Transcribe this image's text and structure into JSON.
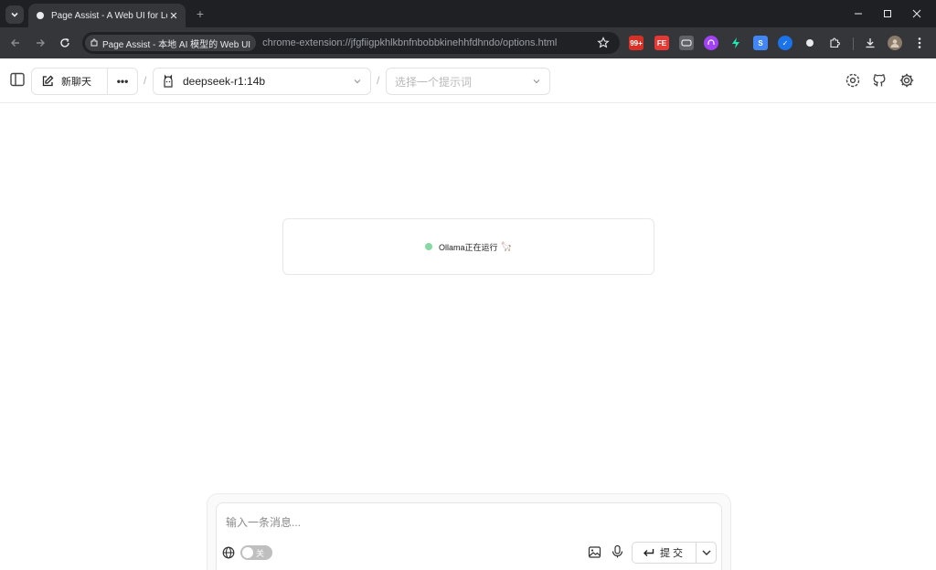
{
  "browser": {
    "tab_title": "Page Assist - A Web UI for Lo",
    "new_tab_symbol": "+",
    "tab_close_symbol": "✕",
    "site_chip_label": "Page Assist - 本地 AI 模型的 Web UI",
    "url": "chrome-extension://jfgfiigpkhlkbnfnbobbkinehhfdhndo/options.html",
    "extensions": [
      {
        "name": "notification-badge-extension",
        "label": "99+",
        "color": "#d93025"
      },
      {
        "name": "fe-extension",
        "label": "FE",
        "color": "#e53935"
      },
      {
        "name": "gamepad-extension",
        "label": "",
        "color": "#5f6368"
      },
      {
        "name": "purple-extension",
        "label": "",
        "color": "#a142f4"
      },
      {
        "name": "bolt-extension",
        "label": "",
        "color": "#1de9b6"
      },
      {
        "name": "s-extension",
        "label": "S",
        "color": "#4285f4"
      },
      {
        "name": "check-extension",
        "label": "✓",
        "color": "#1a73e8"
      },
      {
        "name": "dot-extension",
        "label": "",
        "color": "#e8eaed"
      }
    ]
  },
  "header": {
    "new_chat_label": "新聊天",
    "more_label": "•••",
    "separator": "/",
    "model_name": "deepseek-r1:14b",
    "prompt_placeholder": "选择一个提示词"
  },
  "status": {
    "text": "Ollama正在运行",
    "emoji": "🦙",
    "color": "#86d9a1"
  },
  "composer": {
    "placeholder": "输入一条消息...",
    "web_search_toggle_label": "关",
    "submit_label": "提交"
  }
}
